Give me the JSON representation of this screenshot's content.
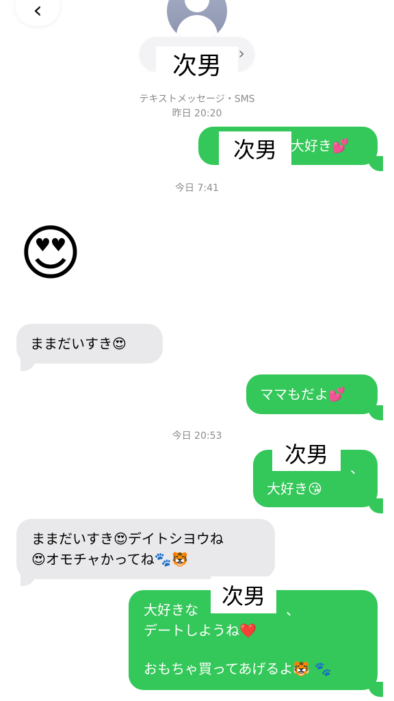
{
  "header": {
    "back_icon": "chevron-left",
    "contact_name": "次男",
    "chevron": "›",
    "service_label": "テキストメッセージ・SMS",
    "first_timestamp": "昨日 20:20"
  },
  "messages": {
    "m1": {
      "visible": "大好き💕",
      "overlay": "次男"
    },
    "ts1": "今日 7:41",
    "m2": {
      "text": "😍"
    },
    "m3": {
      "text": "ままだいすき😍"
    },
    "m4": {
      "text": "ママもだよ💕"
    },
    "ts2": "今日 20:53",
    "m5": {
      "line1": "、",
      "line2": "大好き😘",
      "overlay": "次男"
    },
    "m6": {
      "line1": "ままだいすき😍デイトシヨウね",
      "line2": "😍オモチャかってね🐾🐯"
    },
    "m7": {
      "line1": "大好きな",
      "line1_end": "、",
      "line2": "デートしようね❤️",
      "line3": "おもちゃ買ってあげるよ🐯 🐾",
      "overlay": "次男"
    }
  },
  "colors": {
    "outgoing": "#34c759",
    "incoming": "#e9e9eb",
    "timestamp": "#8a8a8e"
  }
}
